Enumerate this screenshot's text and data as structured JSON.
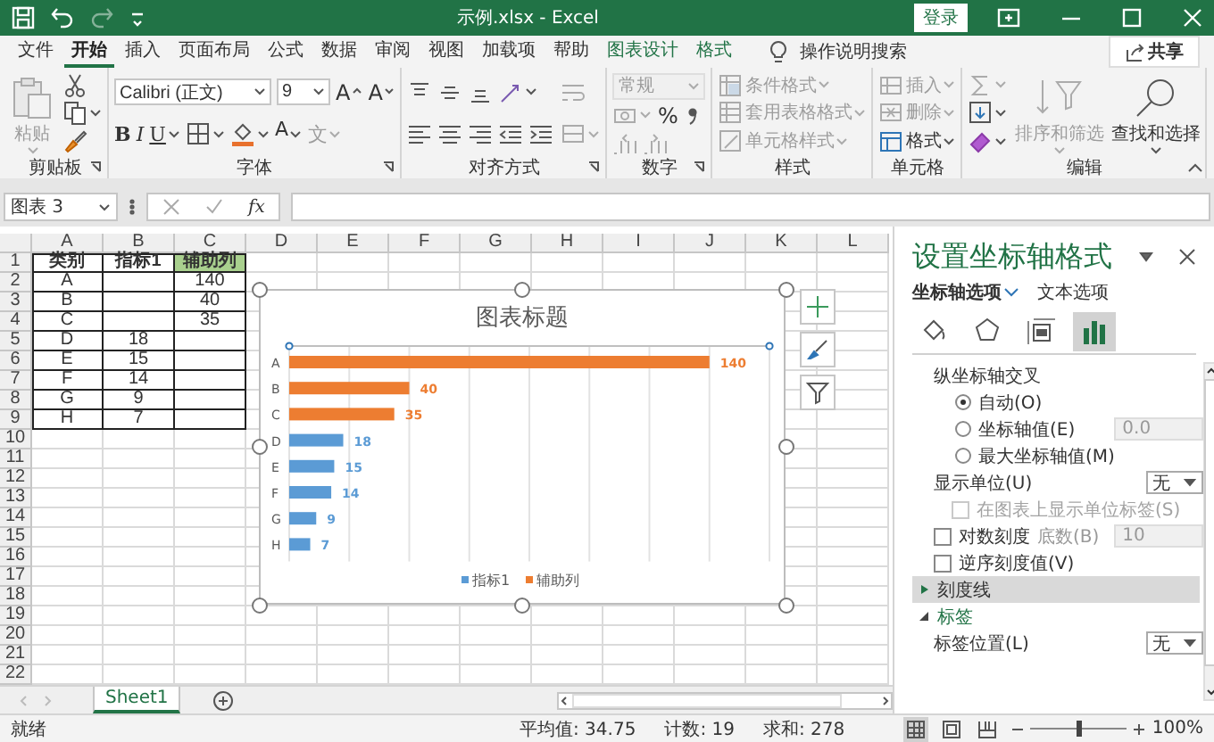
{
  "window": {
    "title": "示例.xlsx  -  Excel",
    "sign_in": "登录"
  },
  "quick_access": [
    {
      "kind": "save",
      "disabled": false
    },
    {
      "kind": "undo",
      "disabled": false
    },
    {
      "kind": "redo",
      "disabled": true
    },
    {
      "kind": "customize",
      "disabled": false
    }
  ],
  "ribbon_tabs": [
    {
      "label": "文件",
      "selected": false,
      "contextual": false
    },
    {
      "label": "开始",
      "selected": true,
      "contextual": false
    },
    {
      "label": "插入",
      "selected": false,
      "contextual": false
    },
    {
      "label": "页面布局",
      "selected": false,
      "contextual": false
    },
    {
      "label": "公式",
      "selected": false,
      "contextual": false
    },
    {
      "label": "数据",
      "selected": false,
      "contextual": false
    },
    {
      "label": "审阅",
      "selected": false,
      "contextual": false
    },
    {
      "label": "视图",
      "selected": false,
      "contextual": false
    },
    {
      "label": "加载项",
      "selected": false,
      "contextual": false
    },
    {
      "label": "帮助",
      "selected": false,
      "contextual": false
    },
    {
      "label": "图表设计",
      "selected": false,
      "contextual": true
    },
    {
      "label": "格式",
      "selected": false,
      "contextual": true
    }
  ],
  "tell_me": "操作说明搜索",
  "share": "共享",
  "ribbon_groups": [
    {
      "label": "剪贴板",
      "launcher": true,
      "blocks": [
        [
          [
            {
              "kind": "paste",
              "label": "粘贴",
              "disabled": true
            }
          ]
        ],
        [
          [
            {
              "kind": "cut",
              "disabled": false
            }
          ],
          [
            {
              "kind": "copy",
              "disabled": false
            }
          ],
          [
            {
              "kind": "painter",
              "disabled": false
            }
          ]
        ]
      ]
    },
    {
      "label": "字体",
      "launcher": true,
      "blocks": [
        [
          [
            {
              "kind": "font",
              "value": "Calibri (正文)",
              "disabled": false
            },
            {
              "kind": "size",
              "value": "9",
              "disabled": false
            },
            {
              "kind": "grow",
              "label": "A",
              "disabled": false
            },
            {
              "kind": "shrink",
              "label": "A",
              "disabled": false
            }
          ],
          [
            {
              "kind": "bold",
              "label": "B",
              "disabled": false
            },
            {
              "kind": "italic",
              "label": "I",
              "disabled": false
            },
            {
              "kind": "underline",
              "label": "U",
              "disabled": false
            },
            {
              "kind": "border",
              "disabled": false
            },
            {
              "kind": "fill",
              "disabled": false
            },
            {
              "kind": "fontcolor",
              "label": "A",
              "disabled": false
            },
            {
              "kind": "phonetic",
              "label": "文",
              "disabled": true
            }
          ]
        ]
      ]
    },
    {
      "label": "对齐方式",
      "launcher": true,
      "blocks": [
        [
          [
            {
              "kind": "top",
              "disabled": false
            },
            {
              "kind": "middle",
              "disabled": false
            },
            {
              "kind": "bottom",
              "disabled": false
            },
            {
              "kind": "orient",
              "disabled": false
            }
          ],
          [
            {
              "kind": "left",
              "disabled": false
            },
            {
              "kind": "center",
              "disabled": false
            },
            {
              "kind": "right",
              "disabled": false
            },
            {
              "kind": "outdent",
              "disabled": false
            },
            {
              "kind": "indent",
              "disabled": false
            }
          ]
        ],
        [
          [
            {
              "kind": "wrap",
              "disabled": true
            }
          ],
          [
            {
              "kind": "merge",
              "disabled": true
            }
          ]
        ]
      ]
    },
    {
      "label": "数字",
      "launcher": true,
      "blocks": [
        [
          [
            {
              "kind": "numfmt",
              "value": "常规",
              "disabled": true
            }
          ],
          [
            {
              "kind": "accounting",
              "disabled": true
            },
            {
              "kind": "percent",
              "label": "%",
              "disabled": false
            },
            {
              "kind": "comma",
              "disabled": false
            }
          ],
          [
            {
              "kind": "incdec",
              "disabled": true
            },
            {
              "kind": "decdec",
              "disabled": true
            }
          ]
        ]
      ]
    },
    {
      "label": "样式",
      "launcher": false,
      "blocks": [
        [
          [
            {
              "kind": "condfmt",
              "label": "条件格式",
              "disabled": true
            }
          ],
          [
            {
              "kind": "tablefmt",
              "label": "套用表格格式",
              "disabled": true
            }
          ],
          [
            {
              "kind": "cellstyle",
              "label": "单元格样式",
              "disabled": true
            }
          ]
        ]
      ]
    },
    {
      "label": "单元格",
      "launcher": false,
      "blocks": [
        [
          [
            {
              "kind": "insert",
              "label": "插入",
              "disabled": true
            }
          ],
          [
            {
              "kind": "delete",
              "label": "删除",
              "disabled": true
            }
          ],
          [
            {
              "kind": "format",
              "label": "格式",
              "disabled": false
            }
          ]
        ]
      ]
    },
    {
      "label": "编辑",
      "launcher": false,
      "blocks": [
        [
          [
            {
              "kind": "sum",
              "disabled": true
            }
          ],
          [
            {
              "kind": "filldown",
              "disabled": false
            }
          ],
          [
            {
              "kind": "clear",
              "disabled": false
            }
          ]
        ],
        [
          [
            {
              "kind": "sort",
              "label": "排序和筛选",
              "disabled": true
            }
          ]
        ],
        [
          [
            {
              "kind": "find",
              "label": "查找和选择",
              "disabled": false
            }
          ]
        ]
      ]
    }
  ],
  "formula_bar": {
    "name_box": "图表 3",
    "function_button": "fx"
  },
  "sheet": {
    "columns": [
      "A",
      "B",
      "C",
      "D",
      "E",
      "F",
      "G",
      "H",
      "I",
      "J",
      "K",
      "L"
    ],
    "row_numbers": [
      "1",
      "2",
      "3",
      "4",
      "5",
      "6",
      "7",
      "8",
      "9",
      "10",
      "11",
      "12",
      "13",
      "14",
      "15",
      "16",
      "17",
      "18",
      "19",
      "20",
      "21",
      "22"
    ],
    "rows": [
      {
        "header": true,
        "cells": [
          {
            "kind": "text",
            "text": "类别",
            "filled": false
          },
          {
            "kind": "text",
            "text": "指标1",
            "filled": false
          },
          {
            "kind": "text",
            "text": "辅助列",
            "filled": true
          }
        ]
      },
      {
        "header": false,
        "cells": [
          {
            "kind": "text",
            "text": "A"
          },
          {
            "kind": "empty"
          },
          {
            "kind": "text",
            "text": "140"
          }
        ]
      },
      {
        "header": false,
        "cells": [
          {
            "kind": "text",
            "text": "B"
          },
          {
            "kind": "empty"
          },
          {
            "kind": "text",
            "text": "40"
          }
        ]
      },
      {
        "header": false,
        "cells": [
          {
            "kind": "text",
            "text": "C"
          },
          {
            "kind": "empty"
          },
          {
            "kind": "text",
            "text": "35"
          }
        ]
      },
      {
        "header": false,
        "cells": [
          {
            "kind": "text",
            "text": "D"
          },
          {
            "kind": "text",
            "text": "18"
          },
          {
            "kind": "empty"
          }
        ]
      },
      {
        "header": false,
        "cells": [
          {
            "kind": "text",
            "text": "E"
          },
          {
            "kind": "text",
            "text": "15"
          },
          {
            "kind": "empty"
          }
        ]
      },
      {
        "header": false,
        "cells": [
          {
            "kind": "text",
            "text": "F"
          },
          {
            "kind": "text",
            "text": "14"
          },
          {
            "kind": "empty"
          }
        ]
      },
      {
        "header": false,
        "cells": [
          {
            "kind": "text",
            "text": "G"
          },
          {
            "kind": "text",
            "text": "9"
          },
          {
            "kind": "empty"
          }
        ]
      },
      {
        "header": false,
        "cells": [
          {
            "kind": "text",
            "text": "H"
          },
          {
            "kind": "text",
            "text": "7"
          },
          {
            "kind": "empty"
          }
        ]
      }
    ]
  },
  "chart": {
    "selected": true,
    "chart_data": {
      "type": "bar",
      "orientation": "horizontal",
      "title": "图表标题",
      "categories": [
        "A",
        "B",
        "C",
        "D",
        "E",
        "F",
        "G",
        "H"
      ],
      "stacked": true,
      "data_labels": true,
      "legend": "bottom",
      "series": [
        {
          "name": "指标1",
          "color": "#5b9bd5",
          "values": [
            null,
            null,
            null,
            18,
            15,
            14,
            9,
            7
          ]
        },
        {
          "name": "辅助列",
          "color": "#ed7d31",
          "values": [
            140,
            40,
            35,
            null,
            null,
            null,
            null,
            null
          ]
        }
      ]
    }
  },
  "sheet_tabs": [
    {
      "label": "Sheet1",
      "selected": true
    }
  ],
  "format_pane": {
    "title": "设置坐标轴格式",
    "tabs": [
      {
        "label": "坐标轴选项",
        "selected": true
      },
      {
        "label": "文本选项",
        "selected": false
      }
    ],
    "icon_tabs": [
      {
        "kind": "fill",
        "selected": false
      },
      {
        "kind": "effects",
        "selected": false
      },
      {
        "kind": "size",
        "selected": false
      },
      {
        "kind": "axis",
        "selected": true
      }
    ],
    "options": [
      {
        "kind": "heading",
        "label": "纵坐标轴交叉"
      },
      {
        "kind": "radio",
        "label": "自动(O)",
        "selected": true
      },
      {
        "kind": "radio",
        "label": "坐标轴值(E)",
        "selected": false,
        "value": "0.0",
        "field_disabled": true
      },
      {
        "kind": "radio",
        "label": "最大坐标轴值(M)",
        "selected": false
      },
      {
        "kind": "dropdown",
        "label": "显示单位(U)",
        "value": "无"
      },
      {
        "kind": "checkbox",
        "label": "在图表上显示单位标签(S)",
        "checked": false,
        "disabled": true
      },
      {
        "kind": "checkbox",
        "label": "对数刻度",
        "checked": false,
        "disabled": false,
        "field_label": "底数(B)",
        "value": "10",
        "field_disabled": true
      },
      {
        "kind": "checkbox",
        "label": "逆序刻度值(V)",
        "checked": false,
        "disabled": false
      },
      {
        "kind": "section",
        "label": "刻度线",
        "expanded": false,
        "highlighted": true
      },
      {
        "kind": "section",
        "label": "标签",
        "expanded": true,
        "highlighted": false
      },
      {
        "kind": "dropdown",
        "label": "标签位置(L)",
        "value": "无"
      }
    ]
  },
  "status_bar": {
    "ready": "就绪",
    "average": "平均值: 34.75",
    "count": "计数: 19",
    "sum": "求和: 278",
    "views": [
      {
        "kind": "normal",
        "selected": true
      },
      {
        "kind": "page-layout",
        "selected": false
      },
      {
        "kind": "page-break",
        "selected": false
      }
    ],
    "zoom": {
      "level": 0.5,
      "label": "100%"
    }
  }
}
